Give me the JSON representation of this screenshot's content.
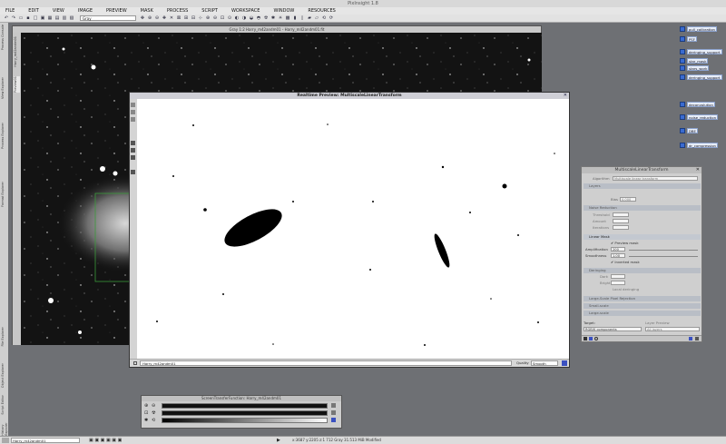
{
  "app": {
    "title": "PixInsight 1.8"
  },
  "menu": [
    "FILE",
    "EDIT",
    "VIEW",
    "IMAGE",
    "PREVIEW",
    "MASK",
    "PROCESS",
    "SCRIPT",
    "WORKSPACE",
    "WINDOW",
    "RESOURCES"
  ],
  "toolbar": {
    "channel_select": "Gray"
  },
  "left_tabs": [
    "Process Console",
    "View Explorer",
    "Process Explorer",
    "Format Explorer",
    "File Explorer",
    "Object Explorer",
    "Script Editor",
    "History Explorer"
  ],
  "image_window": {
    "title": "Gray 1:2 Harry_m42andm01 - Harry_m42andm01.fit",
    "side_tabs": [
      "Harry_m42andm01",
      "Preview01"
    ],
    "preview_id": "Preview01"
  },
  "realtime_preview": {
    "title": "Realtime Preview: MultiscaleLinearTransform",
    "view_name": "Harry_m42andm01",
    "quality_label": "Quality",
    "quality_value": "Smooth"
  },
  "mlt": {
    "title": "MultiscaleLinearTransform",
    "algorithm_label": "Algorithm",
    "algorithm_value": "Multiscale linear transform",
    "layer_sections": [
      "Layers",
      "Noise Reduction",
      "Linear Mask",
      "Deringing",
      "Large-Scale Pixel Rejection",
      "Target"
    ],
    "bias_label": "Bias",
    "bias_value": "0.000",
    "threshold_label": "Threshold",
    "amount_label": "Amount",
    "iterations_label": "Iterations",
    "preview_mask_label": "Preview mask",
    "amplification_label": "Amplification",
    "amplification_value": "200",
    "smoothness_label": "Smoothness",
    "smoothness_value": "1.00",
    "inverted_mask_label": "Inverted mask",
    "dark_label": "Dark",
    "bright_label": "Bright",
    "local_deringing_label": "Local deringing",
    "small_scale_label": "Small-scale",
    "large_scale_label": "Large-scale",
    "target_label": "Target:",
    "target_value": "RGB/K components",
    "layer_preview_label": "Layer Preview",
    "layer_preview_value": "All layers"
  },
  "workspace_icons": [
    "pull_calibration",
    "PSF",
    "deringing_support",
    "star_mask",
    "stars_work",
    "deringing_support",
    "deconvolution",
    "noise_reduction",
    "DBE",
    "dr_compression"
  ],
  "stf": {
    "title": "ScreenTransferFunction: Harry_m42andm01"
  },
  "statusbar": {
    "view": "Harry_m42andm01",
    "coords": "x:3687  y:2205  z:1  712  Gray  31.513 MiB  Modified"
  }
}
